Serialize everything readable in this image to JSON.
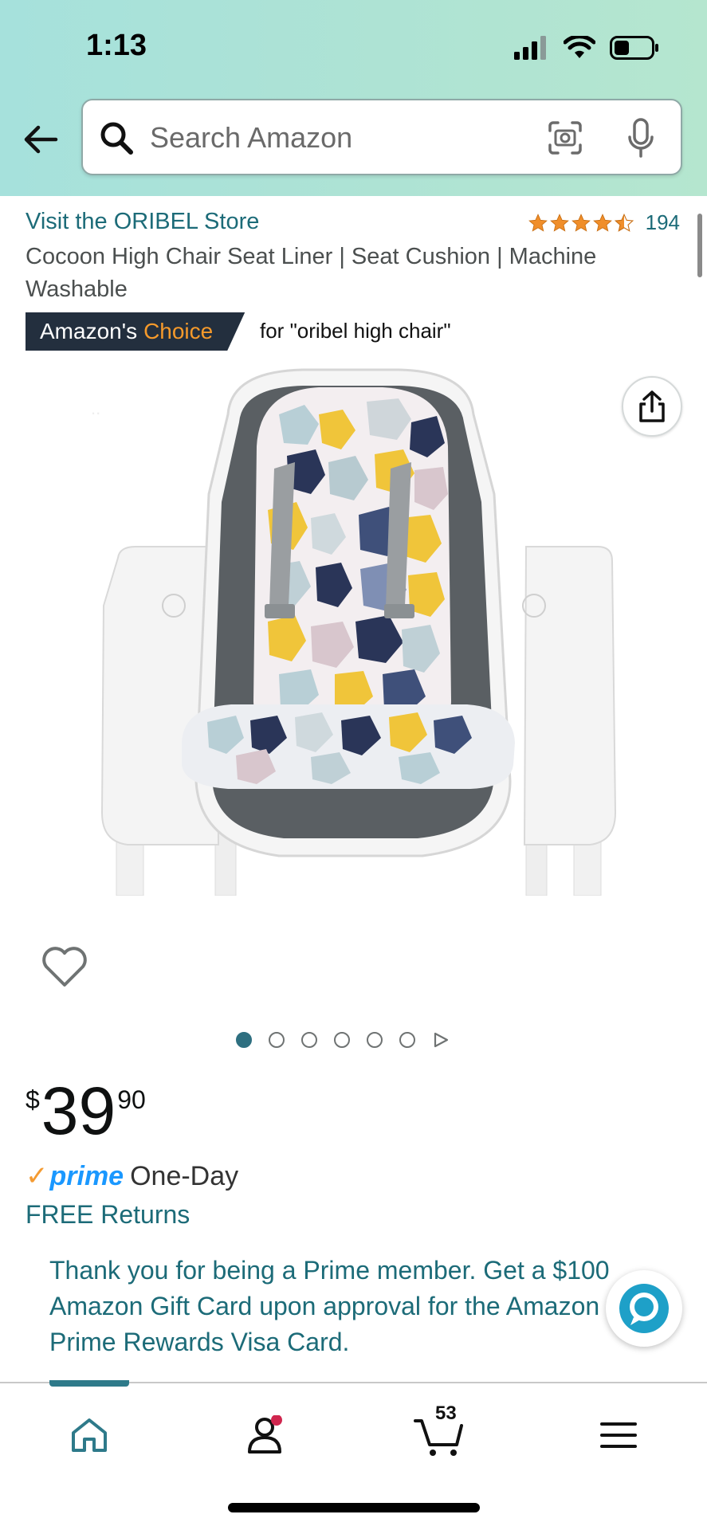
{
  "status_bar": {
    "time": "1:13"
  },
  "search": {
    "placeholder": "Search Amazon"
  },
  "product": {
    "store_link": "Visit the ORIBEL Store",
    "rating_count": "194",
    "title": "Cocoon High Chair Seat Liner | Seat Cushion | Machine Washable",
    "badge_prefix": "Amazon's",
    "badge_word": "Choice",
    "badge_for": "for \"oribel high chair\"",
    "image_count": 6,
    "active_image": 1
  },
  "price": {
    "symbol": "$",
    "whole": "39",
    "fraction": "90"
  },
  "delivery": {
    "prime_label": "prime",
    "prime_speed": "One-Day",
    "returns": "FREE Returns"
  },
  "promo": {
    "line1": "Thank you for being a Prime member. Get a $100",
    "line2": "Amazon Gift Card upon approval for the Amazon",
    "line3": "Prime Rewards Visa Card."
  },
  "bottom_nav": {
    "cart_count": "53",
    "items": [
      "home-icon",
      "account-icon",
      "cart-icon",
      "menu-icon"
    ]
  },
  "colors": {
    "link": "#1c6b78",
    "badge_bg": "#232f3e",
    "badge_accent": "#f69a2b",
    "star": "#f08e2a",
    "prime_blue": "#1a98ff",
    "notification_dot": "#d0264e"
  }
}
